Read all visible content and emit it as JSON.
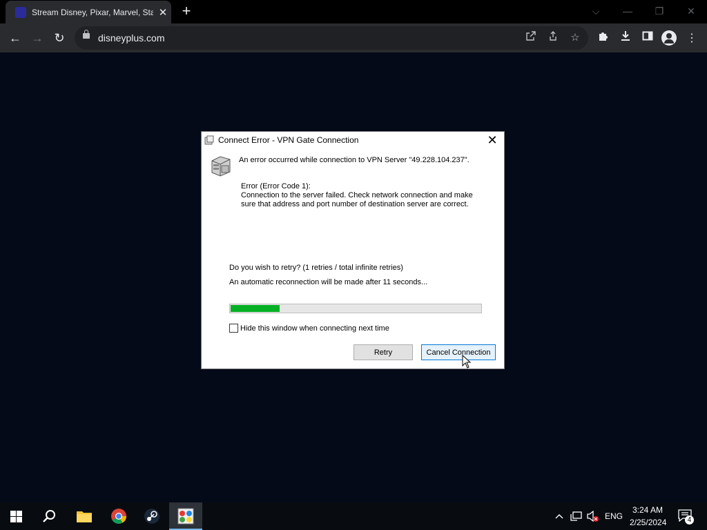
{
  "browser": {
    "tab_title": "Stream Disney, Pixar, Marvel, Sta",
    "tab_close": "✕",
    "new_tab": "+",
    "url": "disneyplus.com",
    "controls": {
      "dropdown": "⌵",
      "minimize": "—",
      "restore": "❐",
      "close": "✕"
    },
    "nav": {
      "back": "←",
      "forward": "→",
      "reload": "↻"
    }
  },
  "dialog": {
    "title": "Connect Error - VPN Gate Connection",
    "close": "✕",
    "message": "An error occurred while connection to VPN Server \"49.228.104.237\".",
    "error_code": "Error (Error Code 1):",
    "error_desc": "Connection to the server failed. Check network connection and make sure that address and port number of destination server are correct.",
    "retry_question": "Do you wish to retry? (1 retries / total infinite retries)",
    "auto_reconnect": "An automatic reconnection will be made after 11 seconds...",
    "progress_fraction": 0.195,
    "hide_checkbox_label": "Hide this window when connecting next time",
    "hide_checked": false,
    "retry_button": "Retry",
    "cancel_button": "Cancel Connection"
  },
  "taskbar": {
    "language": "ENG",
    "time": "3:24 AM",
    "date": "2/25/2024",
    "notification_count": "4",
    "apps": [
      "start-icon",
      "search-icon",
      "file-explorer-icon",
      "chrome-icon",
      "steam-icon",
      "vpn-gate-icon"
    ]
  },
  "colors": {
    "progress": "#06b025",
    "accent": "#0078d7",
    "page_background": "#040a18"
  }
}
